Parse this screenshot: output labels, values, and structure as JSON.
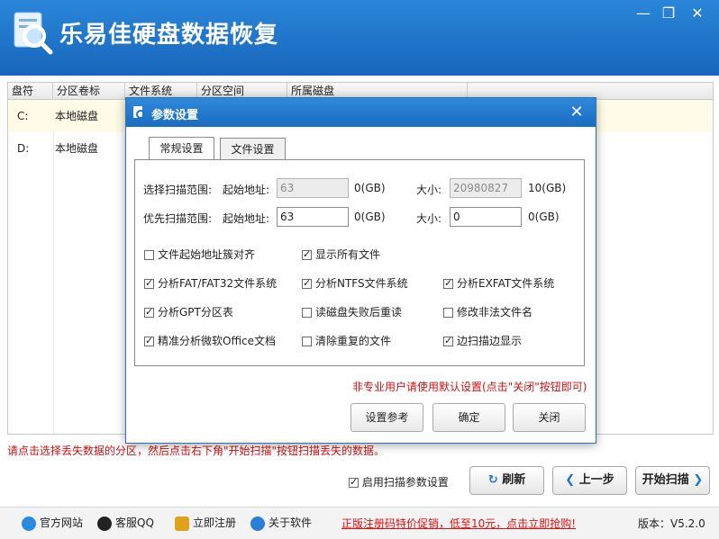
{
  "app": {
    "title": "乐易佳硬盘数据恢复",
    "window_controls": [
      "minimize-icon",
      "restore-icon",
      "close-icon"
    ]
  },
  "table": {
    "columns": [
      "盘符",
      "分区卷标",
      "文件系统",
      "分区空间",
      "所属磁盘"
    ],
    "rows": [
      {
        "drive": "C:",
        "label": "本地磁盘"
      },
      {
        "drive": "D:",
        "label": "本地磁盘"
      }
    ]
  },
  "status": {
    "message": "请点击选择丢失数据的分区，然后点击右下角\"开始扫描\"按钮扫描丢失的数据。"
  },
  "controls": {
    "enable_scan_params_label": "启用扫描参数设置",
    "enable_scan_params_checked": true,
    "refresh": "刷新",
    "prev": "上一步",
    "start": "开始扫描"
  },
  "footer": {
    "links": [
      {
        "label": "官方网站",
        "icon": "ie-icon"
      },
      {
        "label": "客服QQ",
        "icon": "qq-icon"
      },
      {
        "label": "立即注册",
        "icon": "key-icon"
      },
      {
        "label": "关于软件",
        "icon": "info-icon"
      }
    ],
    "promo": "正版注册码特价促销，低至10元，点击立即抢购!",
    "version": "版本：V5.2.0"
  },
  "dialog": {
    "title": "参数设置",
    "tabs": [
      "常规设置",
      "文件设置"
    ],
    "active_tab": "常规设置",
    "scan_range": {
      "label": "选择扫描范围:",
      "start_label": "起始地址:",
      "start_value": "63",
      "start_unit": "0(GB)",
      "size_label": "大小:",
      "size_value": "20980827",
      "size_unit": "10(GB)"
    },
    "priority_range": {
      "label": "优先扫描范围:",
      "start_label": "起始地址:",
      "start_value": "63",
      "start_unit": "0(GB)",
      "size_label": "大小:",
      "size_value": "0",
      "size_unit": "0(GB)"
    },
    "options": [
      {
        "label": "文件起始地址簇对齐",
        "checked": false
      },
      {
        "label": "显示所有文件",
        "checked": true
      },
      {
        "label": "分析FAT/FAT32文件系统",
        "checked": true
      },
      {
        "label": "分析NTFS文件系统",
        "checked": true
      },
      {
        "label": "分析EXFAT文件系统",
        "checked": true
      },
      {
        "label": "分析GPT分区表",
        "checked": true
      },
      {
        "label": "读磁盘失败后重读",
        "checked": false
      },
      {
        "label": "修改非法文件名",
        "checked": false
      },
      {
        "label": "精准分析微软Office文档",
        "checked": true
      },
      {
        "label": "清除重复的文件",
        "checked": false
      },
      {
        "label": "边扫描边显示",
        "checked": true
      }
    ],
    "hint": "非专业用户请使用默认设置(点击\"关闭\"按钮即可)",
    "buttons": [
      "设置参考",
      "确定",
      "关闭"
    ]
  },
  "colors": {
    "title_bar": "#1f74c8",
    "accent_red": "#d01010"
  }
}
